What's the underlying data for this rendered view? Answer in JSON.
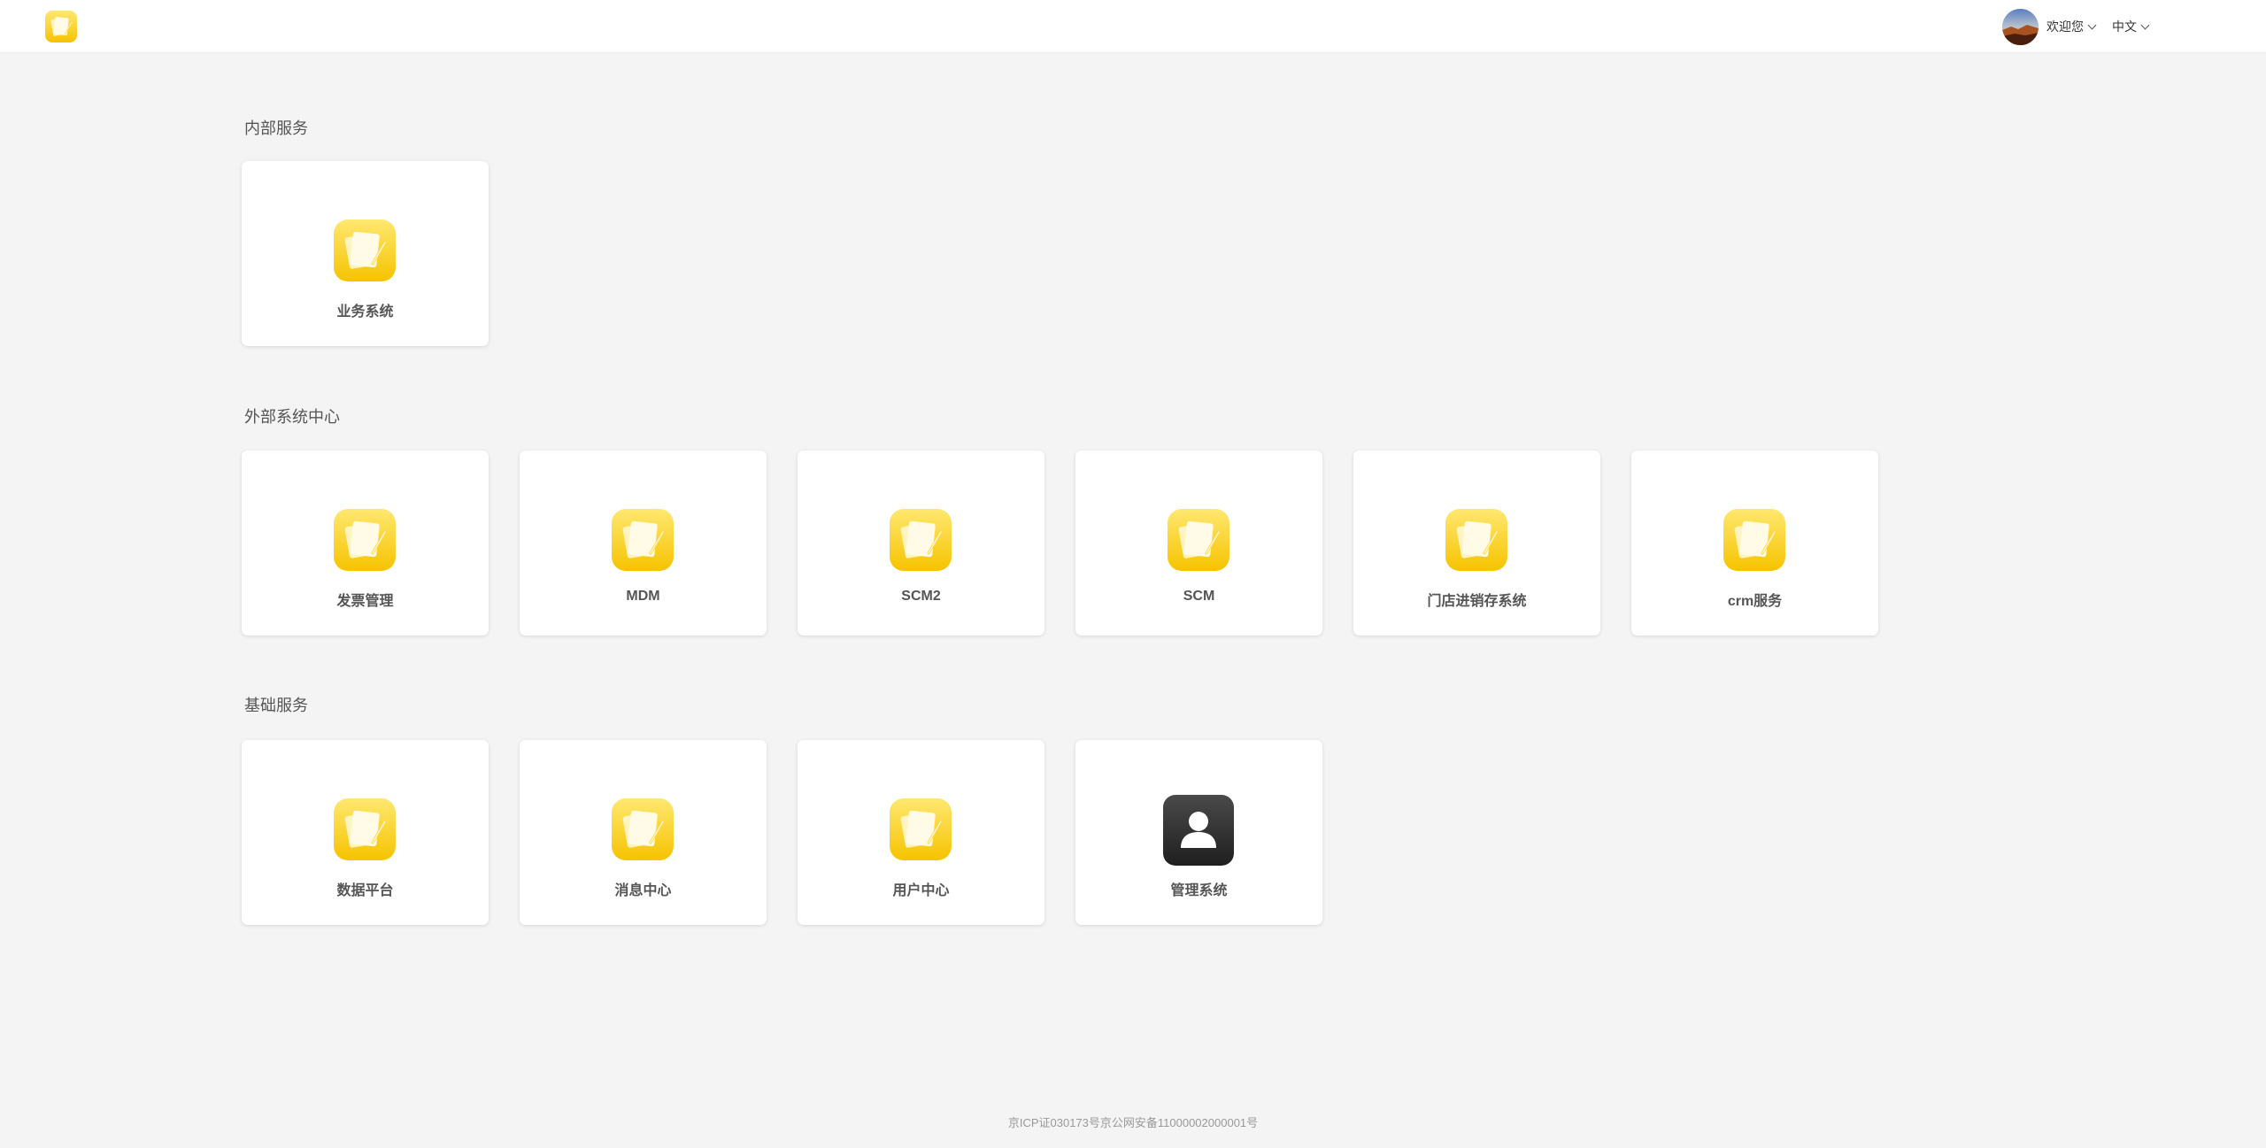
{
  "header": {
    "welcome_label": "欢迎您",
    "language_label": "中文",
    "logo_icon": "notes-app-icon",
    "avatar_icon": "user-avatar"
  },
  "sections": [
    {
      "title": "内部服务",
      "apps": [
        {
          "label": "业务系统",
          "icon": "notes-app-icon"
        }
      ]
    },
    {
      "title": "外部系统中心",
      "apps": [
        {
          "label": "发票管理",
          "icon": "notes-app-icon"
        },
        {
          "label": "MDM",
          "icon": "notes-app-icon"
        },
        {
          "label": "SCM2",
          "icon": "notes-app-icon"
        },
        {
          "label": "SCM",
          "icon": "notes-app-icon"
        },
        {
          "label": "门店进销存系统",
          "icon": "notes-app-icon"
        },
        {
          "label": "crm服务",
          "icon": "notes-app-icon"
        }
      ]
    },
    {
      "title": "基础服务",
      "apps": [
        {
          "label": "数据平台",
          "icon": "notes-app-icon"
        },
        {
          "label": "消息中心",
          "icon": "notes-app-icon"
        },
        {
          "label": "用户中心",
          "icon": "notes-app-icon"
        },
        {
          "label": "管理系统",
          "icon": "person-app-icon"
        }
      ]
    }
  ],
  "footer": {
    "text": "京ICP证030173号京公网安备11000002000001号"
  },
  "colors": {
    "background": "#f4f4f4",
    "card": "#ffffff",
    "icon_yellow_top": "#ffe45a",
    "icon_yellow_bottom": "#f5c400",
    "icon_dark": "#2b2b2b"
  }
}
